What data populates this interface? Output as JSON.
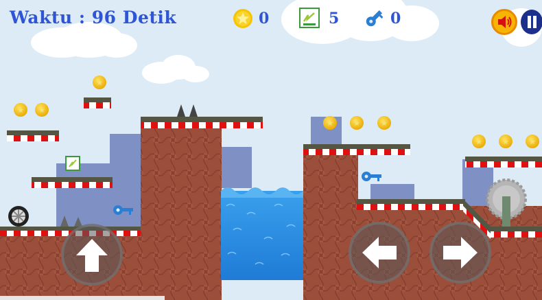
{
  "hud": {
    "timer_text": "Waktu : 96 Detik",
    "coins": "0",
    "power_cards": "5",
    "keys": "0"
  },
  "colors": {
    "sky": "#dcebf5",
    "hud_text": "#2f55d4",
    "dirt": "#9b4e3a",
    "water": "#2a8fe0",
    "platform_top": "#555544",
    "stripe_red": "#e01010",
    "coin": "#f6c400",
    "key": "#2a7fd4",
    "building": "#7f91c4"
  },
  "icons": {
    "coin_counter": "star-coin-icon",
    "card_counter": "power-card-icon",
    "key_counter": "key-icon",
    "sound": "speaker-icon",
    "pause": "pause-icon",
    "jump": "up-arrow-icon",
    "left": "left-arrow-icon",
    "right": "right-arrow-icon"
  }
}
